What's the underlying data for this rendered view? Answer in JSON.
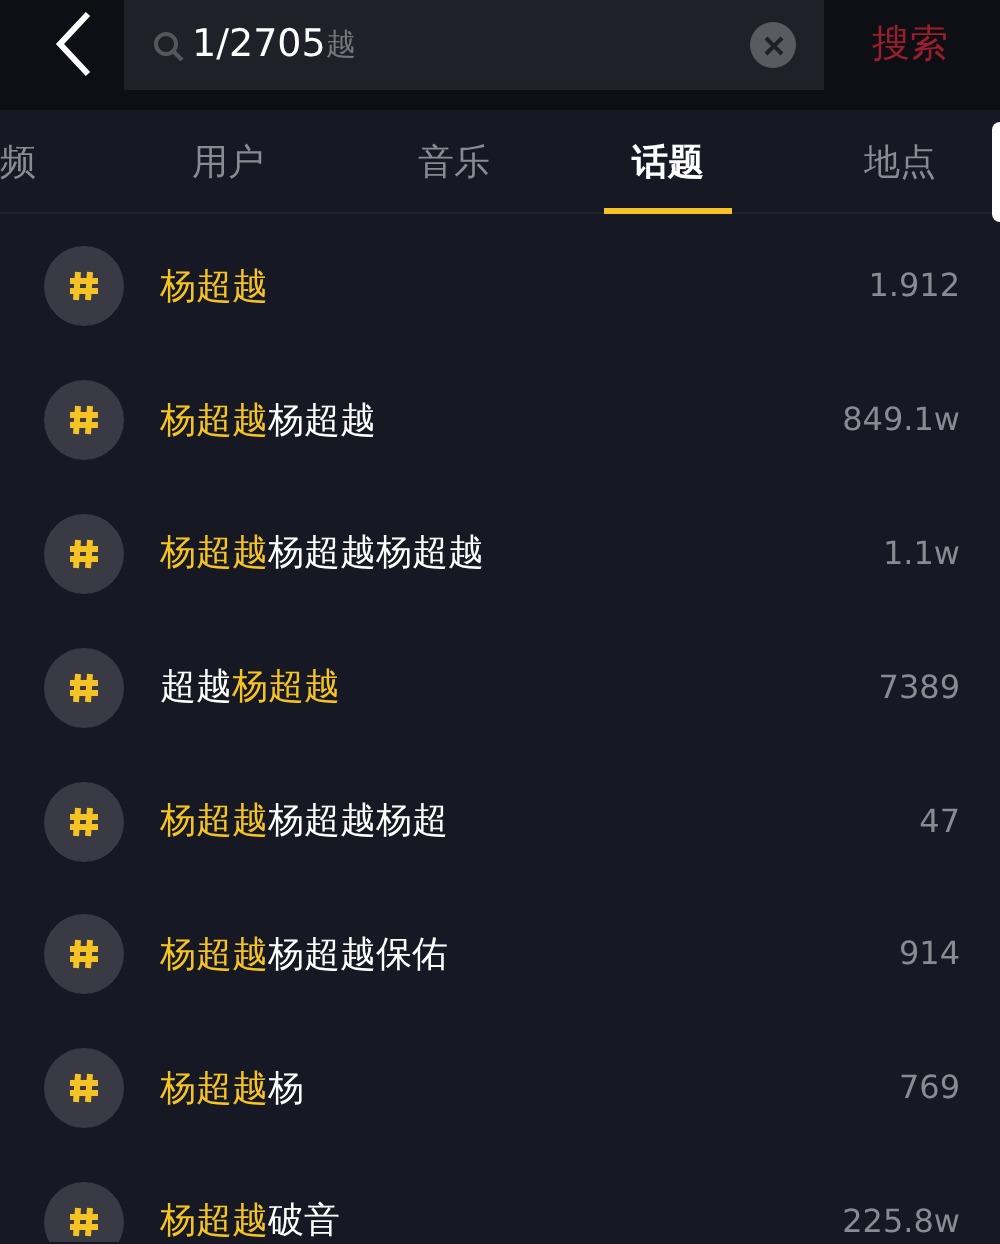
{
  "header": {
    "counter": "1/2705",
    "search_text": "越",
    "search_button": "搜索"
  },
  "tabs": [
    {
      "label": "频",
      "selected": false
    },
    {
      "label": "用户",
      "selected": false
    },
    {
      "label": "音乐",
      "selected": false
    },
    {
      "label": "话题",
      "selected": true
    },
    {
      "label": "地点",
      "selected": false
    }
  ],
  "topics": [
    {
      "parts": [
        {
          "text": "杨超越",
          "highlight": true
        }
      ],
      "count": "1.912"
    },
    {
      "parts": [
        {
          "text": "杨超越",
          "highlight": true
        },
        {
          "text": "杨超越",
          "highlight": false
        }
      ],
      "count": "849.1w"
    },
    {
      "parts": [
        {
          "text": "杨超越",
          "highlight": true
        },
        {
          "text": "杨超越杨超越",
          "highlight": false
        }
      ],
      "count": "1.1w"
    },
    {
      "parts": [
        {
          "text": "超越",
          "highlight": false
        },
        {
          "text": "杨超越",
          "highlight": true
        }
      ],
      "count": "7389"
    },
    {
      "parts": [
        {
          "text": "杨超越",
          "highlight": true
        },
        {
          "text": "杨超越杨超",
          "highlight": false
        }
      ],
      "count": "47"
    },
    {
      "parts": [
        {
          "text": "杨超越",
          "highlight": true
        },
        {
          "text": "杨超越保佑",
          "highlight": false
        }
      ],
      "count": "914"
    },
    {
      "parts": [
        {
          "text": "杨超越",
          "highlight": true
        },
        {
          "text": "杨",
          "highlight": false
        }
      ],
      "count": "769"
    },
    {
      "parts": [
        {
          "text": "杨超越",
          "highlight": true
        },
        {
          "text": "破音",
          "highlight": false
        }
      ],
      "count": "225.8w"
    }
  ]
}
